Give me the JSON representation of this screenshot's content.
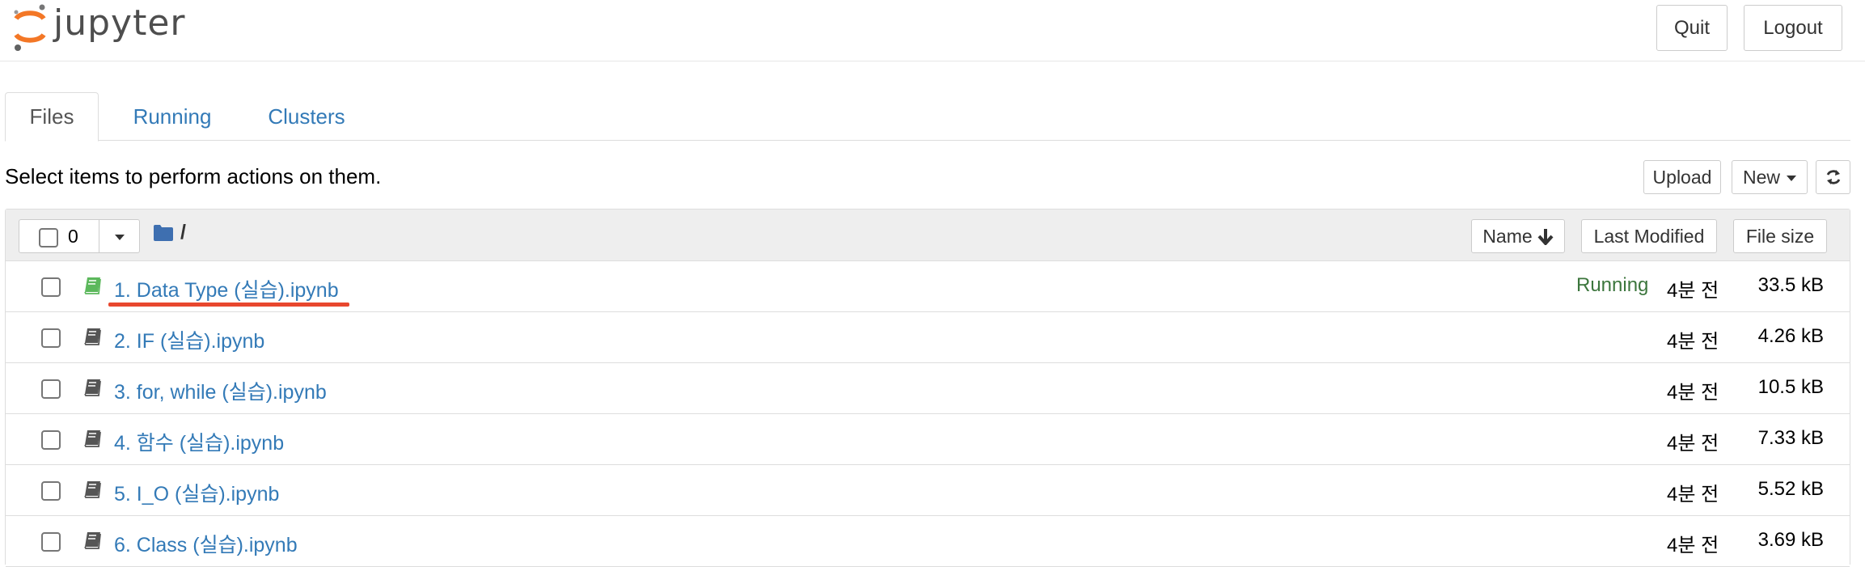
{
  "header": {
    "logo_text": "jupyter",
    "quit_label": "Quit",
    "logout_label": "Logout"
  },
  "tabs": [
    {
      "label": "Files",
      "active": true
    },
    {
      "label": "Running",
      "active": false
    },
    {
      "label": "Clusters",
      "active": false
    }
  ],
  "toolbar": {
    "hint": "Select items to perform actions on them.",
    "upload_label": "Upload",
    "new_label": "New",
    "refresh_icon": "refresh-icon"
  },
  "listing": {
    "selected_count": "0",
    "path": "/",
    "sort_name": "Name",
    "sort_modified": "Last Modified",
    "sort_size": "File size",
    "files": [
      {
        "name": "1. Data Type (실습).ipynb",
        "status": "Running",
        "modified": "4분 전",
        "size": "33.5 kB"
      },
      {
        "name": "2. IF (실습).ipynb",
        "status": "",
        "modified": "4분 전",
        "size": "4.26 kB"
      },
      {
        "name": "3. for, while (실습).ipynb",
        "status": "",
        "modified": "4분 전",
        "size": "10.5 kB"
      },
      {
        "name": "4. 함수 (실습).ipynb",
        "status": "",
        "modified": "4분 전",
        "size": "7.33 kB"
      },
      {
        "name": "5. I_O (실습).ipynb",
        "status": "",
        "modified": "4분 전",
        "size": "5.52 kB"
      },
      {
        "name": "6. Class (실습).ipynb",
        "status": "",
        "modified": "4분 전",
        "size": "3.69 kB"
      }
    ]
  },
  "colors": {
    "link": "#337ab7",
    "running": "#3c763d",
    "active_notebook_icon": "#5cb85c",
    "annotation": "#e8472e",
    "logo_orange": "#f37726"
  }
}
